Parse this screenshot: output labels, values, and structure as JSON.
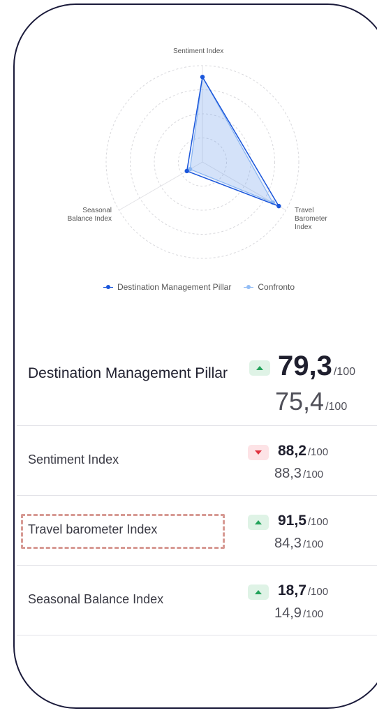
{
  "radar": {
    "axes": [
      "Sentiment Index",
      "Travel\nBarometer\nIndex",
      "Seasonal\nBalance Index"
    ],
    "axis_labels": {
      "sentiment": "Sentiment Index",
      "travel_1": "Travel",
      "travel_2": "Barometer",
      "travel_3": "Index",
      "seasonal_1": "Seasonal",
      "seasonal_2": "Balance Index"
    },
    "series": [
      {
        "name": "Destination Management Pillar",
        "color": "#1a56db",
        "values": [
          88.2,
          91.5,
          18.7
        ]
      },
      {
        "name": "Confronto",
        "color": "#93bdf5",
        "values": [
          88.3,
          84.3,
          14.9
        ]
      }
    ],
    "max": 100
  },
  "legend": {
    "series1": "Destination Management Pillar",
    "series2": "Confronto"
  },
  "rows": [
    {
      "label": "Destination Management Pillar",
      "trend": "up",
      "value": "79,3",
      "compare": "75,4",
      "of": "/100"
    },
    {
      "label": "Sentiment Index",
      "trend": "down",
      "value": "88,2",
      "compare": "88,3",
      "of": "/100"
    },
    {
      "label": "Travel barometer Index",
      "trend": "up",
      "value": "91,5",
      "compare": "84,3",
      "of": "/100"
    },
    {
      "label": "Seasonal Balance Index",
      "trend": "up",
      "value": "18,7",
      "compare": "14,9",
      "of": "/100"
    }
  ],
  "colors": {
    "up_badge": "#dff3e6",
    "up_arrow": "#22a35a",
    "down_badge": "#fde3e6",
    "down_arrow": "#e0313e",
    "highlight_border": "#d79a94"
  }
}
